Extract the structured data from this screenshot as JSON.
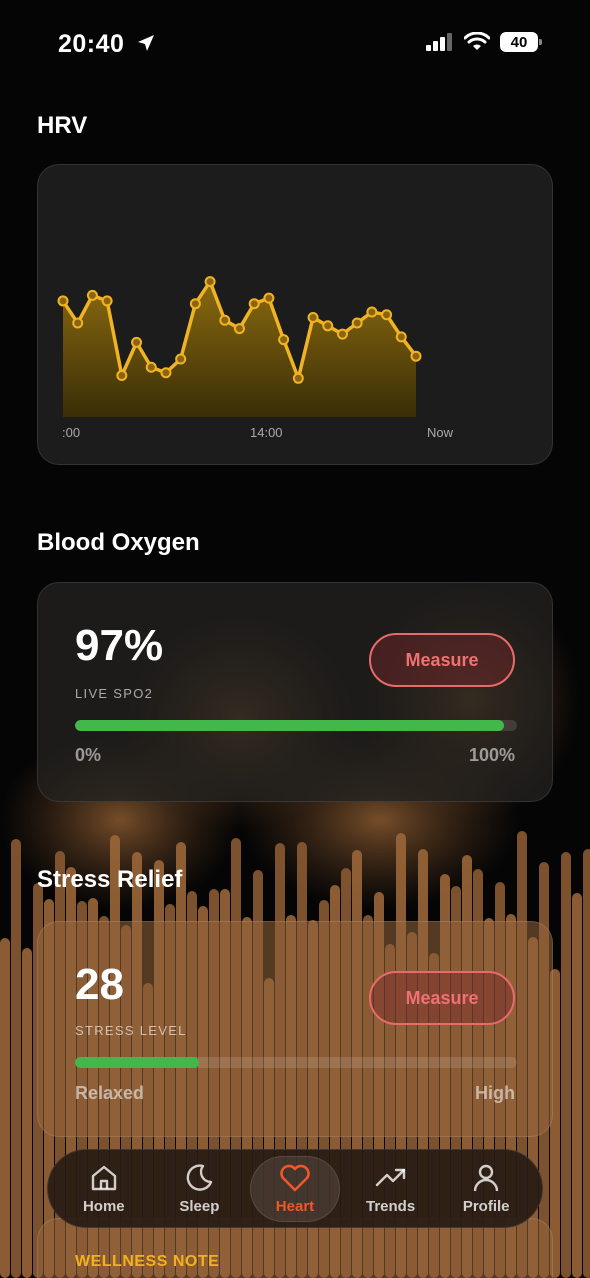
{
  "status_bar": {
    "time": "20:40",
    "battery": "40",
    "icons": [
      "location-arrow-icon",
      "signal-icon",
      "wifi-icon",
      "battery-icon"
    ]
  },
  "hrv": {
    "title": "HRV",
    "chart_data": {
      "type": "area",
      "x_tick_labels": [
        ":00",
        "14:00",
        "Now"
      ],
      "values": [
        62,
        54,
        64,
        62,
        35,
        47,
        38,
        36,
        41,
        61,
        69,
        55,
        52,
        61,
        63,
        48,
        34,
        56,
        53,
        50,
        54,
        58,
        57,
        49,
        42
      ],
      "color": "#f0b323",
      "grid": false,
      "legend": "none"
    }
  },
  "blood_oxygen": {
    "title": "Blood Oxygen",
    "value": "97%",
    "label": "LIVE SPO2",
    "button": "Measure",
    "progress": 0.97,
    "range_min": "0%",
    "range_max": "100%"
  },
  "stress": {
    "title": "Stress Relief",
    "value": "28",
    "label": "STRESS LEVEL",
    "button": "Measure",
    "progress": 0.28,
    "range_min": "Relaxed",
    "range_max": "High"
  },
  "wellness": {
    "label": "WELLNESS NOTE"
  },
  "tabs": [
    {
      "label": "Home",
      "icon": "home-icon",
      "active": false
    },
    {
      "label": "Sleep",
      "icon": "moon-icon",
      "active": false
    },
    {
      "label": "Heart",
      "icon": "heart-icon",
      "active": true
    },
    {
      "label": "Trends",
      "icon": "trend-icon",
      "active": false
    },
    {
      "label": "Profile",
      "icon": "person-icon",
      "active": false
    }
  ],
  "colors": {
    "accent": "#f0572a",
    "hrv_line": "#f0b323",
    "progress": "#43b84a",
    "measure": "#f07171",
    "note": "#f2b21b"
  }
}
